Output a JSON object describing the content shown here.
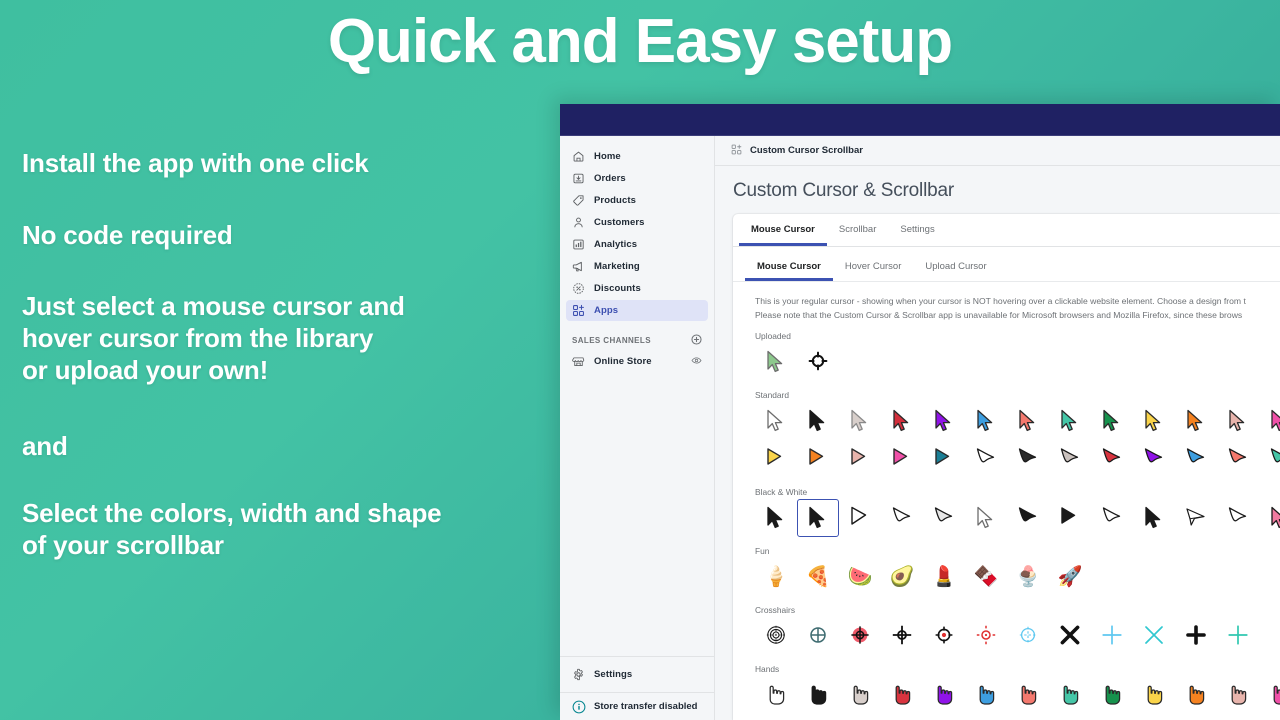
{
  "promo": {
    "title": "Quick and Easy setup",
    "blocks": [
      [
        "Install the app with one click"
      ],
      [
        "No code required"
      ],
      [
        "Just select a mouse cursor and",
        "hover cursor from the library",
        "or upload your own!"
      ],
      [
        "and"
      ],
      [
        "Select the colors, width and shape",
        "of your scrollbar"
      ]
    ]
  },
  "admin": {
    "sidebar": {
      "items": [
        {
          "label": "Home",
          "icon": "home-icon",
          "active": false
        },
        {
          "label": "Orders",
          "icon": "orders-icon",
          "active": false
        },
        {
          "label": "Products",
          "icon": "products-tag-icon",
          "active": false
        },
        {
          "label": "Customers",
          "icon": "customers-icon",
          "active": false
        },
        {
          "label": "Analytics",
          "icon": "analytics-bars-icon",
          "active": false
        },
        {
          "label": "Marketing",
          "icon": "marketing-megaphone-icon",
          "active": false
        },
        {
          "label": "Discounts",
          "icon": "discounts-percent-icon",
          "active": false
        },
        {
          "label": "Apps",
          "icon": "apps-grid-plus-icon",
          "active": true
        }
      ],
      "sales_channels_label": "SALES CHANNELS",
      "sales_channels": [
        {
          "label": "Online Store",
          "icon": "storefront-icon",
          "trailing_icon": "eye-icon"
        }
      ],
      "settings_label": "Settings",
      "store_transfer_label": "Store transfer disabled"
    },
    "breadcrumb": "Custom Cursor Scrollbar",
    "page_title": "Custom Cursor & Scrollbar",
    "tabs": [
      {
        "label": "Mouse Cursor",
        "active": true
      },
      {
        "label": "Scrollbar",
        "active": false
      },
      {
        "label": "Settings",
        "active": false
      }
    ],
    "subtabs": [
      {
        "label": "Mouse Cursor",
        "active": true
      },
      {
        "label": "Hover Cursor",
        "active": false
      },
      {
        "label": "Upload Cursor",
        "active": false
      }
    ],
    "description_line1": "This is your regular cursor - showing when your cursor is NOT hovering over a clickable website element. Choose a design from t",
    "description_line2": "Please note that the Custom Cursor & Scrollbar app is unavailable for Microsoft browsers and Mozilla Firefox, since these brows",
    "groups": [
      {
        "label": "Uploaded",
        "rows": [
          [
            {
              "type": "arrow",
              "fill": "#8dc98d",
              "stroke": "#6d6d6d",
              "selected": false
            },
            {
              "type": "crosshair-ring",
              "color": "#111111",
              "selected": false
            }
          ]
        ]
      },
      {
        "label": "Standard",
        "rows": [
          [
            {
              "type": "arrow",
              "fill": "#ffffff",
              "stroke": "#6d6d6d",
              "selected": false
            },
            {
              "type": "arrow",
              "fill": "#1a1a1a",
              "stroke": "#1a1a1a",
              "selected": false
            },
            {
              "type": "arrow",
              "fill": "#d8cfcb",
              "stroke": "#8a8a8a",
              "selected": false
            },
            {
              "type": "arrow",
              "fill": "#d32f3c",
              "stroke": "#2a2a2a",
              "selected": false
            },
            {
              "type": "arrow",
              "fill": "#9013e8",
              "stroke": "#2a2a2a",
              "selected": false
            },
            {
              "type": "arrow",
              "fill": "#3d9ee0",
              "stroke": "#2a2a2a",
              "selected": false
            },
            {
              "type": "arrow",
              "fill": "#f4796e",
              "stroke": "#2a2a2a",
              "selected": false
            },
            {
              "type": "arrow",
              "fill": "#45c6a7",
              "stroke": "#2a2a2a",
              "selected": false
            },
            {
              "type": "arrow",
              "fill": "#17924d",
              "stroke": "#2a2a2a",
              "selected": false
            },
            {
              "type": "arrow",
              "fill": "#fad44a",
              "stroke": "#2a2a2a",
              "selected": false
            },
            {
              "type": "arrow",
              "fill": "#f58220",
              "stroke": "#2a2a2a",
              "selected": false
            },
            {
              "type": "arrow",
              "fill": "#e8b4ac",
              "stroke": "#2a2a2a",
              "selected": false
            },
            {
              "type": "arrow",
              "fill": "#f050a8",
              "stroke": "#2a2a2a",
              "selected": false
            }
          ],
          [
            {
              "type": "tri",
              "fill": "#fad44a",
              "stroke": "#2a2a2a",
              "selected": false
            },
            {
              "type": "tri",
              "fill": "#f58220",
              "stroke": "#2a2a2a",
              "selected": false
            },
            {
              "type": "tri",
              "fill": "#e8b4ac",
              "stroke": "#2a2a2a",
              "selected": false
            },
            {
              "type": "tri",
              "fill": "#f050a8",
              "stroke": "#2a2a2a",
              "selected": false
            },
            {
              "type": "tri",
              "fill": "#1b7f96",
              "stroke": "#2a2a2a",
              "selected": false
            },
            {
              "type": "swoop",
              "fill": "#ffffff",
              "stroke": "#1a1a1a",
              "selected": false
            },
            {
              "type": "swoop",
              "fill": "#2a2a2a",
              "stroke": "#1a1a1a",
              "selected": false
            },
            {
              "type": "swoop",
              "fill": "#cbc2be",
              "stroke": "#1a1a1a",
              "selected": false
            },
            {
              "type": "swoop",
              "fill": "#d9343f",
              "stroke": "#1a1a1a",
              "selected": false
            },
            {
              "type": "swoop",
              "fill": "#9013e8",
              "stroke": "#1a1a1a",
              "selected": false
            },
            {
              "type": "swoop",
              "fill": "#3d9ee0",
              "stroke": "#1a1a1a",
              "selected": false
            },
            {
              "type": "swoop",
              "fill": "#f4796e",
              "stroke": "#1a1a1a",
              "selected": false
            },
            {
              "type": "swoop",
              "fill": "#45c6a7",
              "stroke": "#1a1a1a",
              "selected": false
            }
          ]
        ]
      },
      {
        "label": "Black & White",
        "rows": [
          [
            {
              "type": "arrow",
              "fill": "#1a1a1a",
              "stroke": "#1a1a1a",
              "selected": false
            },
            {
              "type": "arrow-bold",
              "fill": "#1a1a1a",
              "stroke": "#1a1a1a",
              "selected": true
            },
            {
              "type": "arrow-outline",
              "fill": "#ffffff",
              "stroke": "#1a1a1a",
              "selected": false
            },
            {
              "type": "swoop",
              "fill": "#ffffff",
              "stroke": "#1a1a1a",
              "selected": false
            },
            {
              "type": "swoop-grad",
              "fill": "#e6e6e6",
              "stroke": "#1a1a1a",
              "selected": false
            },
            {
              "type": "arrow",
              "fill": "#ffffff",
              "stroke": "#6d6d6d",
              "selected": false
            },
            {
              "type": "swoop-solid",
              "fill": "#1a1a1a",
              "stroke": "#1a1a1a",
              "selected": false
            },
            {
              "type": "tri-solid",
              "fill": "#1a1a1a",
              "stroke": "#1a1a1a",
              "selected": false
            },
            {
              "type": "swoop",
              "fill": "#ffffff",
              "stroke": "#1a1a1a",
              "selected": false
            },
            {
              "type": "arrow",
              "fill": "#1a1a1a",
              "stroke": "#1a1a1a",
              "selected": false
            },
            {
              "type": "paper-plane",
              "fill": "#ffffff",
              "stroke": "#1a1a1a",
              "selected": false
            },
            {
              "type": "swoop",
              "fill": "#ffffff",
              "stroke": "#1a1a1a",
              "selected": false
            },
            {
              "type": "arrow-rainbow",
              "fill": "#f0a070",
              "stroke": "#1a1a1a",
              "selected": false
            }
          ]
        ]
      },
      {
        "label": "Fun",
        "rows": [
          [
            {
              "type": "emoji",
              "glyph": "🍦",
              "name": "ice-cream-bar-icon",
              "selected": false
            },
            {
              "type": "emoji",
              "glyph": "🍕",
              "name": "pizza-icon",
              "selected": false
            },
            {
              "type": "emoji",
              "glyph": "🍉",
              "name": "watermelon-icon",
              "selected": false
            },
            {
              "type": "emoji",
              "glyph": "🥑",
              "name": "avocado-icon",
              "selected": false
            },
            {
              "type": "emoji",
              "glyph": "💄",
              "name": "lipstick-icon",
              "selected": false
            },
            {
              "type": "emoji",
              "glyph": "🍫",
              "name": "popsicle-icon",
              "selected": false
            },
            {
              "type": "emoji",
              "glyph": "🍨",
              "name": "ice-cream-cone-icon",
              "selected": false
            },
            {
              "type": "emoji",
              "glyph": "🚀",
              "name": "rocket-icon",
              "selected": false
            }
          ]
        ]
      },
      {
        "label": "Crosshairs",
        "rows": [
          [
            {
              "type": "ch-rings",
              "color": "#1a1a1a",
              "selected": false
            },
            {
              "type": "ch-plus-circle",
              "color": "#3e6b70",
              "selected": false
            },
            {
              "type": "ch-filled",
              "color": "#ef5a6a",
              "selected": false
            },
            {
              "type": "ch-cross-ring",
              "color": "#111111",
              "selected": false
            },
            {
              "type": "ch-dot",
              "color": "#111111",
              "dot": "#e03030",
              "selected": false
            },
            {
              "type": "ch-small",
              "color": "#e03030",
              "selected": false
            },
            {
              "type": "ch-light",
              "color": "#5ec8f0",
              "selected": false
            },
            {
              "type": "x-bold",
              "color": "#111111",
              "selected": false
            },
            {
              "type": "plus-thin",
              "color": "#5ec8f0",
              "selected": false
            },
            {
              "type": "x-thin",
              "color": "#30c8d0",
              "selected": false
            },
            {
              "type": "plus-fat",
              "color": "#111111",
              "selected": false
            },
            {
              "type": "plus-thin",
              "color": "#30c8b0",
              "selected": false
            }
          ]
        ]
      },
      {
        "label": "Hands",
        "rows": [
          [
            {
              "type": "hand",
              "fill": "#ffffff",
              "stroke": "#2a2a2a",
              "selected": false
            },
            {
              "type": "hand",
              "fill": "#1a1a1a",
              "stroke": "#1a1a1a",
              "selected": false
            },
            {
              "type": "hand",
              "fill": "#d8cfcb",
              "stroke": "#2a2a2a",
              "selected": false
            },
            {
              "type": "hand",
              "fill": "#d9343f",
              "stroke": "#2a2a2a",
              "selected": false
            },
            {
              "type": "hand",
              "fill": "#9013e8",
              "stroke": "#2a2a2a",
              "selected": false
            },
            {
              "type": "hand",
              "fill": "#3d9ee0",
              "stroke": "#2a2a2a",
              "selected": false
            },
            {
              "type": "hand",
              "fill": "#f4796e",
              "stroke": "#2a2a2a",
              "selected": false
            },
            {
              "type": "hand",
              "fill": "#45c6a7",
              "stroke": "#2a2a2a",
              "selected": false
            },
            {
              "type": "hand",
              "fill": "#17924d",
              "stroke": "#2a2a2a",
              "selected": false
            },
            {
              "type": "hand",
              "fill": "#fad44a",
              "stroke": "#2a2a2a",
              "selected": false
            },
            {
              "type": "hand",
              "fill": "#f58220",
              "stroke": "#2a2a2a",
              "selected": false
            },
            {
              "type": "hand",
              "fill": "#e8b4ac",
              "stroke": "#2a2a2a",
              "selected": false
            },
            {
              "type": "hand",
              "fill": "#f050a8",
              "stroke": "#2a2a2a",
              "selected": false
            }
          ]
        ]
      }
    ]
  },
  "colors": {
    "brand_green_start": "#3fbfa0",
    "brand_green_end": "#2f9f92",
    "topbar_navy": "#1f2163",
    "accent_blue": "#3c52b2",
    "sidebar_bg": "#f4f6f8",
    "active_nav_bg": "#dfe3f7"
  }
}
